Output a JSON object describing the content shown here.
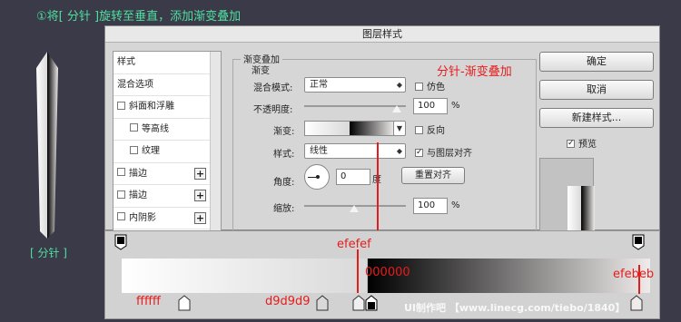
{
  "caption": "①将[ 分针 ]旋转至垂直，添加渐变叠加",
  "needle_label": "[ 分针 ]",
  "dialog": {
    "title": "图层样式",
    "left_items": [
      {
        "label": "样式",
        "checkbox": false,
        "plus": false
      },
      {
        "label": "混合选项",
        "checkbox": false,
        "plus": false
      },
      {
        "label": "斜面和浮雕",
        "checkbox": true,
        "plus": false
      },
      {
        "label": "等高线",
        "checkbox": true,
        "plus": false,
        "sub": true
      },
      {
        "label": "纹理",
        "checkbox": true,
        "plus": false,
        "sub": true
      },
      {
        "label": "描边",
        "checkbox": true,
        "plus": true
      },
      {
        "label": "描边",
        "checkbox": true,
        "plus": true
      },
      {
        "label": "内阴影",
        "checkbox": true,
        "plus": true
      }
    ],
    "group_title": "渐变叠加",
    "sub_title": "渐变",
    "blend_mode_label": "混合模式:",
    "blend_mode_value": "正常",
    "dither_label": "仿色",
    "opacity_label": "不透明度:",
    "opacity_value": "100",
    "percent": "%",
    "gradient_label": "渐变:",
    "reverse_label": "反向",
    "style_label": "样式:",
    "style_value": "线性",
    "align_label": "与图层对齐",
    "angle_label": "角度:",
    "angle_value": "0",
    "degree": "度",
    "reset_align": "重置对齐",
    "scale_label": "缩放:",
    "scale_value": "100",
    "ok": "确定",
    "cancel": "取消",
    "new_style": "新建样式...",
    "preview_label": "预览"
  },
  "annotation": "分针-渐变叠加",
  "stops": {
    "top_left_label": "",
    "mid_top": "efefef",
    "mid_bottom": "000000",
    "right_top": "efebeb",
    "left_bottom": "ffffff",
    "mid_left_bottom": "d9d9d9"
  },
  "watermark": "UI制作吧 【www.linecg.com/tiebo/1840】",
  "colors": {
    "accent_green": "#4fe0a0",
    "annotation_red": "#e61c1c"
  }
}
